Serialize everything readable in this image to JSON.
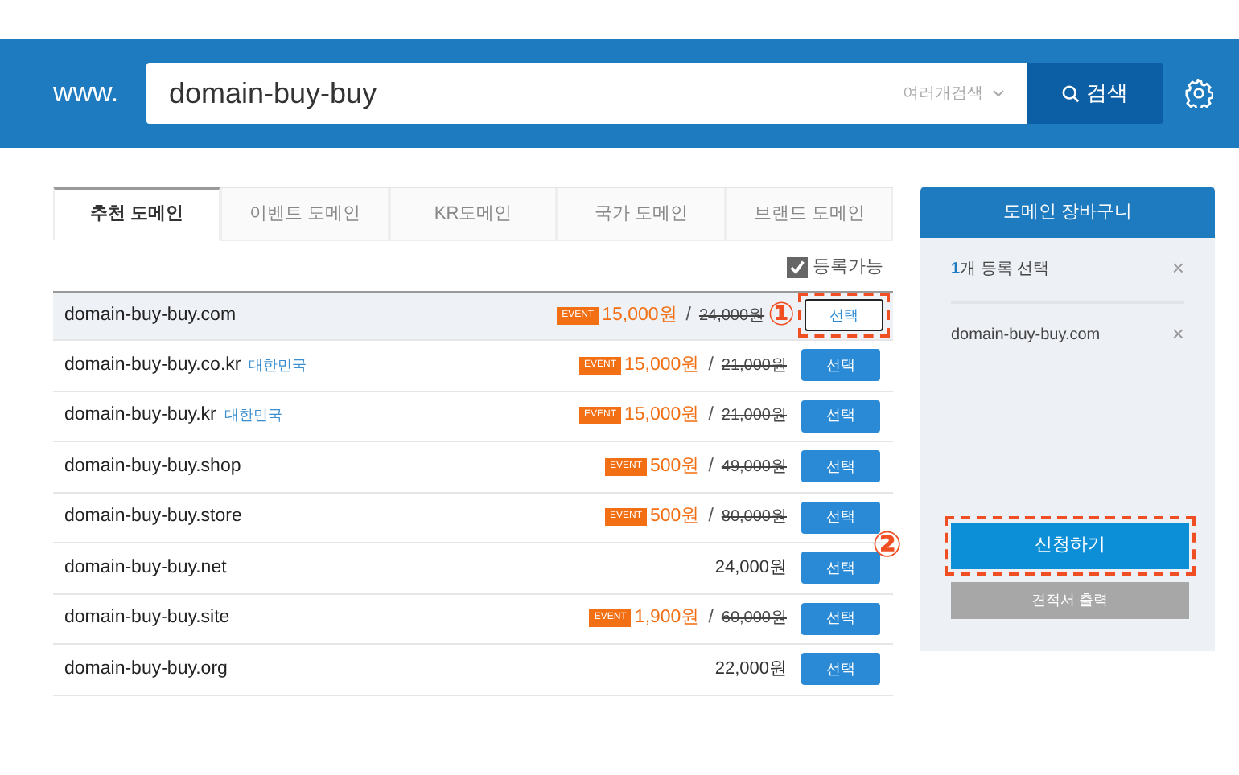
{
  "header": {
    "prefix": "www.",
    "search": {
      "value": "domain-buy-buy",
      "option": "여러개검색",
      "button": "검색"
    }
  },
  "tabs": [
    {
      "label": "추천 도메인",
      "selected": true
    },
    {
      "label": "이벤트 도메인",
      "selected": false
    },
    {
      "label": "KR도메인",
      "selected": false
    },
    {
      "label": "국가 도메인",
      "selected": false
    },
    {
      "label": "브랜드 도메인",
      "selected": false
    }
  ],
  "filter": {
    "label": "등록가능",
    "checked": true
  },
  "domains": [
    {
      "name": "domain-buy-buy.com",
      "event": "EVENT",
      "price": "15,000원",
      "separator": "/",
      "old_price": "24,000원",
      "button": "선택",
      "selected": true,
      "annotation": "①"
    },
    {
      "name": "domain-buy-buy.co.kr",
      "tag": "대한민국",
      "event": "EVENT",
      "price": "15,000원",
      "separator": "/",
      "old_price": "21,000원",
      "button": "선택",
      "selected": false
    },
    {
      "name": "domain-buy-buy.kr",
      "tag": "대한민국",
      "event": "EVENT",
      "price": "15,000원",
      "separator": "/",
      "old_price": "21,000원",
      "button": "선택",
      "selected": false
    },
    {
      "name": "domain-buy-buy.shop",
      "event": "EVENT",
      "price": "500원",
      "separator": "/",
      "old_price": "49,000원",
      "button": "선택",
      "selected": false
    },
    {
      "name": "domain-buy-buy.store",
      "event": "EVENT",
      "price": "500원",
      "separator": "/",
      "old_price": "80,000원",
      "button": "선택",
      "selected": false
    },
    {
      "name": "domain-buy-buy.net",
      "price": "24,000원",
      "button": "선택",
      "selected": false
    },
    {
      "name": "domain-buy-buy.site",
      "event": "EVENT",
      "price": "1,900원",
      "separator": "/",
      "old_price": "60,000원",
      "button": "선택",
      "selected": false
    },
    {
      "name": "domain-buy-buy.org",
      "price": "22,000원",
      "button": "선택",
      "selected": false
    }
  ],
  "cart": {
    "title": "도메인 장바구니",
    "summary": "**1**개 등록 선택",
    "close": "×",
    "items": [
      {
        "name": "domain-buy-buy.com",
        "close": "×"
      }
    ],
    "apply": {
      "label": "신청하기",
      "annotation": "②"
    },
    "quote": "견적서 출력"
  }
}
